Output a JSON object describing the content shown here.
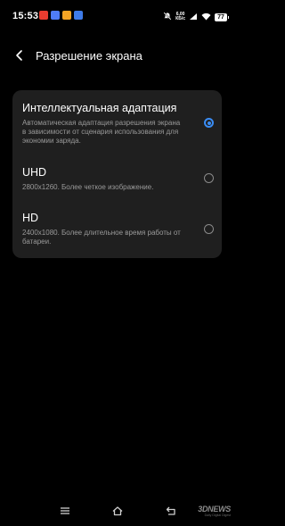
{
  "status_bar": {
    "time": "15:53",
    "notifications": [
      {
        "icon": "yandex-icon",
        "color": "#e83c2f"
      },
      {
        "icon": "blue-app-icon",
        "color": "#4f7cf7"
      },
      {
        "icon": "orange-app-icon",
        "color": "#f4a424"
      },
      {
        "icon": "image-app-icon",
        "color": "#3e7be8"
      }
    ],
    "speed_value": "6,00",
    "speed_unit": "КБ/с",
    "battery": "77"
  },
  "header": {
    "title": "Разрешение экрана"
  },
  "options": [
    {
      "title": "Интеллектуальная адаптация",
      "description": "Автоматическая адаптация разрешения экрана в зависимости от сценария использования для экономии заряда.",
      "selected": true
    },
    {
      "title": "UHD",
      "description": "2800x1260. Более четкое изображение.",
      "selected": false
    },
    {
      "title": "HD",
      "description": "2400x1080. Более длительное время работы от батареи.",
      "selected": false
    }
  ],
  "watermark": {
    "logo": "3DNEWS",
    "tagline": "Daily Digital Digest"
  },
  "colors": {
    "accent": "#3a8cf3",
    "card_bg": "#1f1f1f",
    "background": "#000000"
  }
}
